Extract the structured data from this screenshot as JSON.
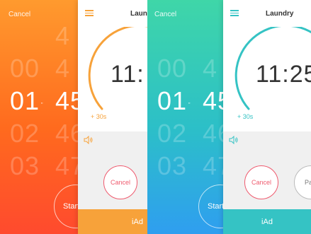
{
  "colors": {
    "orange_accent": "#f7a23a",
    "teal_accent": "#35c3c4",
    "cancel_red": "#ef5a6e"
  },
  "left_picker": {
    "cancel": "Cancel",
    "minutes": [
      "",
      "00",
      "01",
      "02",
      "03"
    ],
    "seconds": [
      "4",
      "4",
      "45",
      "46",
      "47"
    ],
    "selected_minutes": "01",
    "selected_seconds": "45",
    "unit": "\"",
    "start": "Start"
  },
  "left_timer": {
    "title": "Laundry",
    "time": "11:",
    "plus30": "+ 30s",
    "cancel": "Cancel",
    "iad": "iAd"
  },
  "right_picker": {
    "cancel": "Cancel",
    "minutes": [
      "",
      "00",
      "01",
      "02",
      "03"
    ],
    "seconds": [
      "",
      "4",
      "45",
      "46",
      "47"
    ],
    "selected_minutes": "01",
    "selected_seconds": "45",
    "unit": "\"",
    "start": "Start"
  },
  "right_timer": {
    "title": "Laundry",
    "time": "11:25",
    "plus30": "+ 30s",
    "cancel": "Cancel",
    "pause": "Pause",
    "iad": "iAd"
  }
}
